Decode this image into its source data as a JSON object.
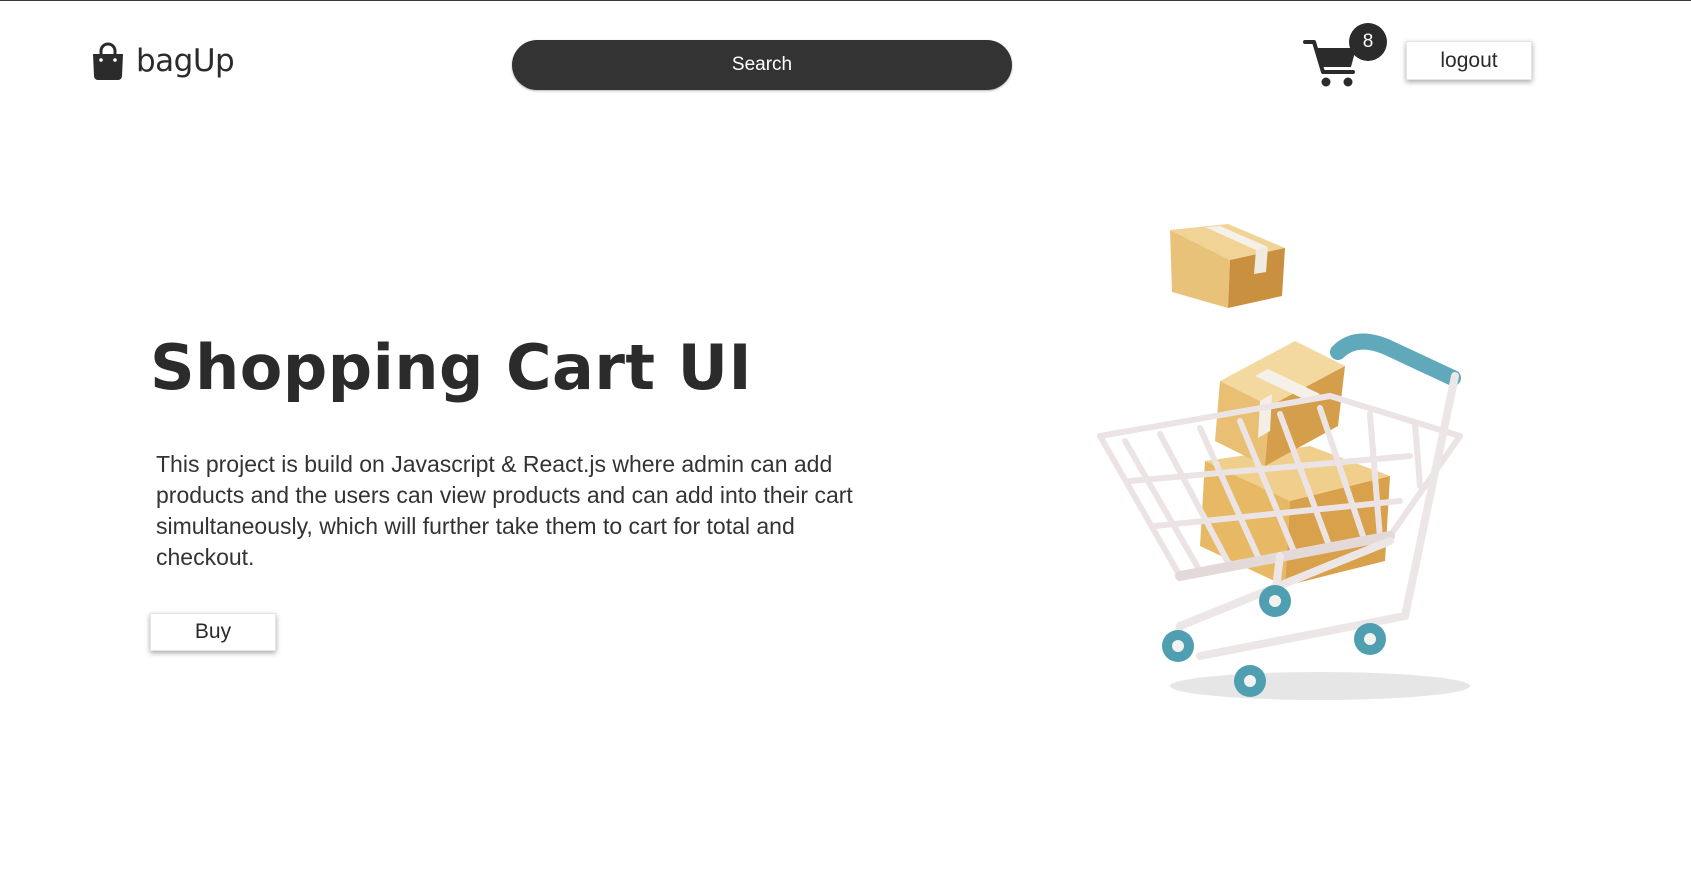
{
  "header": {
    "brand": "bagUp",
    "search_label": "Search",
    "cart_count": "8",
    "logout_label": "logout"
  },
  "hero": {
    "title": "Shopping Cart UI",
    "description": "This project is build on Javascript & React.js where admin can add products and the users can view products and can add into their cart simultaneously, which will further take them to cart for total and checkout.",
    "buy_label": "Buy"
  },
  "icons": {
    "logo": "shopping-bag-icon",
    "cart": "shopping-cart-icon",
    "illustration": "shopping-cart-with-boxes-illustration"
  },
  "colors": {
    "dark": "#2b2b2b",
    "search_bg": "#333333",
    "box": "#e8b864",
    "cart_wheel": "#4f9fb0"
  }
}
